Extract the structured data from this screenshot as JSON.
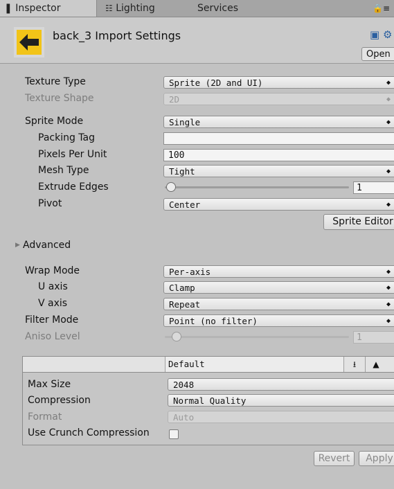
{
  "tabs": {
    "inspector": "Inspector",
    "lighting": "Lighting",
    "services": "Services",
    "lock_icon": "lock-icon",
    "menu_icon": "menu-icon"
  },
  "header": {
    "title": "back_3 Import Settings",
    "open_label": "Open",
    "asset_icon": "back-arrow-icon",
    "icon_color": "#f2c418"
  },
  "settings": {
    "texture_type_label": "Texture Type",
    "texture_type_value": "Sprite (2D and UI)",
    "texture_shape_label": "Texture Shape",
    "texture_shape_value": "2D",
    "sprite_mode_label": "Sprite Mode",
    "sprite_mode_value": "Single",
    "packing_tag_label": "Packing Tag",
    "packing_tag_value": "",
    "ppu_label": "Pixels Per Unit",
    "ppu_value": "100",
    "mesh_type_label": "Mesh Type",
    "mesh_type_value": "Tight",
    "extrude_label": "Extrude Edges",
    "extrude_value": "1",
    "extrude_fraction": 0.03,
    "pivot_label": "Pivot",
    "pivot_value": "Center",
    "sprite_editor_label": "Sprite Editor",
    "advanced_label": "Advanced",
    "wrap_mode_label": "Wrap Mode",
    "wrap_mode_value": "Per-axis",
    "u_axis_label": "U axis",
    "u_axis_value": "Clamp",
    "v_axis_label": "V axis",
    "v_axis_value": "Repeat",
    "filter_mode_label": "Filter Mode",
    "filter_mode_value": "Point (no filter)",
    "aniso_label": "Aniso Level",
    "aniso_value": "1",
    "aniso_fraction": 0.06
  },
  "platform": {
    "default_tab": "Default",
    "max_size_label": "Max Size",
    "max_size_value": "2048",
    "compression_label": "Compression",
    "compression_value": "Normal Quality",
    "format_label": "Format",
    "format_value": "Auto",
    "crunch_label": "Use Crunch Compression",
    "crunch_checked": false
  },
  "footer": {
    "revert_label": "Revert",
    "apply_label": "Apply"
  }
}
